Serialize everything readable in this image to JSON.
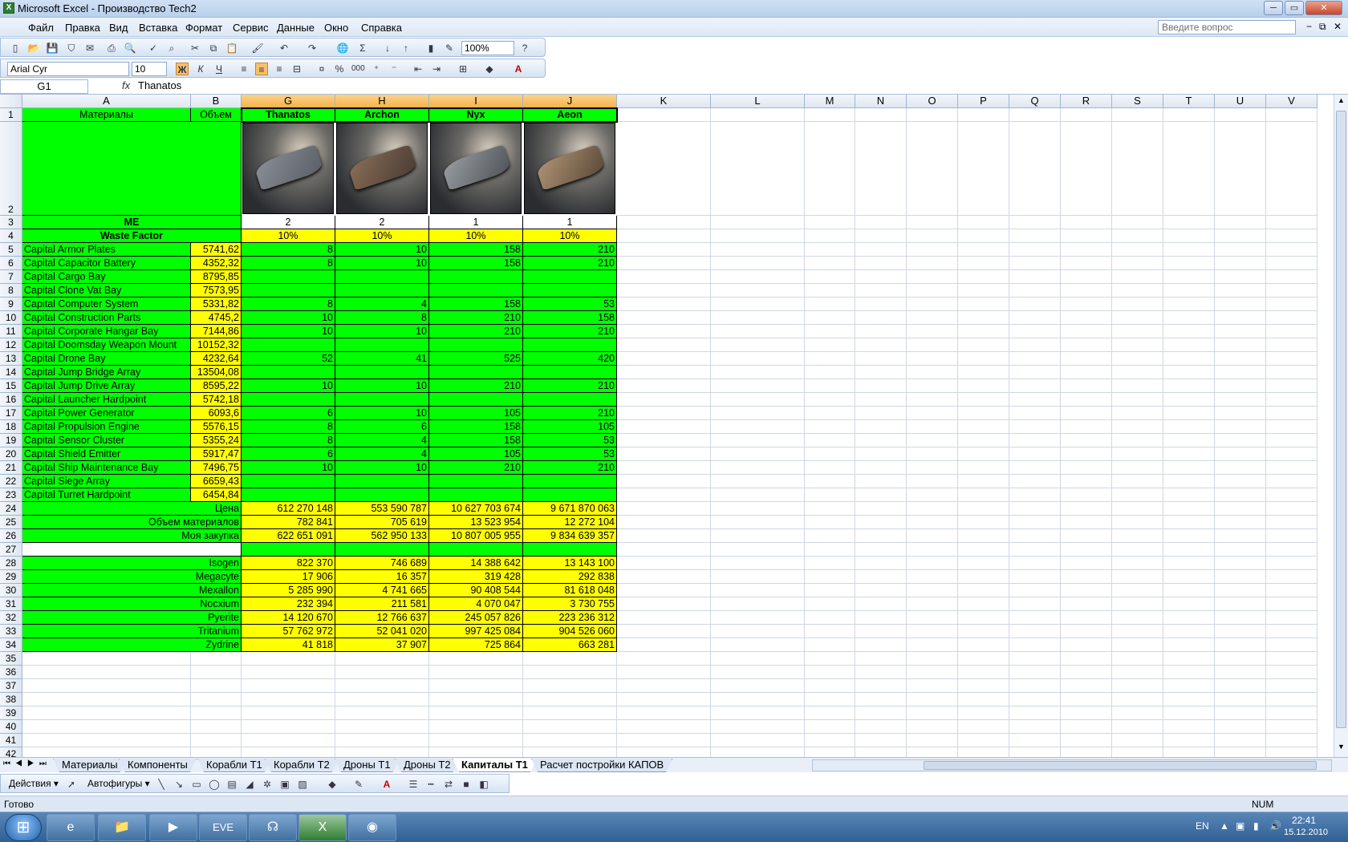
{
  "window": {
    "title": "Microsoft Excel - Производство Tech2",
    "btn_min": "─",
    "btn_max": "▭",
    "btn_close": "✕",
    "doc_min": "−",
    "doc_restore": "⧉",
    "doc_close": "✕"
  },
  "menu": {
    "items": [
      "Файл",
      "Правка",
      "Вид",
      "Вставка",
      "Формат",
      "Сервис",
      "Данные",
      "Окно",
      "Справка"
    ],
    "ask_placeholder": "Введите вопрос"
  },
  "toolbar": {
    "zoom": "100%",
    "font": "Arial Cyr",
    "size": "10",
    "bold": "Ж",
    "italic": "К",
    "underline": "Ч",
    "percent": "%",
    "thousands": "000"
  },
  "formula": {
    "namebox": "G1",
    "fx": "fx",
    "content": "Thanatos"
  },
  "columns": [
    "A",
    "B",
    "G",
    "H",
    "I",
    "J",
    "K",
    "L",
    "M",
    "N",
    "O",
    "P",
    "Q",
    "R",
    "S",
    "T",
    "U",
    "V"
  ],
  "rows": [
    "1",
    "2",
    "3",
    "4",
    "5",
    "6",
    "7",
    "8",
    "9",
    "10",
    "11",
    "12",
    "13",
    "14",
    "15",
    "16",
    "17",
    "18",
    "19",
    "20",
    "21",
    "22",
    "23",
    "24",
    "25",
    "26",
    "27",
    "28",
    "29",
    "30",
    "31",
    "32",
    "33",
    "34",
    "35",
    "36",
    "37",
    "38",
    "39",
    "40",
    "41",
    "42"
  ],
  "sheet": {
    "header": {
      "a": "Материалы",
      "b": "Объем",
      "ships": [
        "Thanatos",
        "Archon",
        "Nyx",
        "Aeon"
      ]
    },
    "me": {
      "label": "ME",
      "values": [
        "2",
        "2",
        "1",
        "1"
      ]
    },
    "waste": {
      "label": "Waste Factor",
      "values": [
        "10%",
        "10%",
        "10%",
        "10%"
      ]
    },
    "materials": [
      {
        "name": "Capital Armor Plates",
        "vol": "5741,62",
        "v": [
          "8",
          "10",
          "158",
          "210"
        ]
      },
      {
        "name": "Capital Capacitor Battery",
        "vol": "4352,32",
        "v": [
          "8",
          "10",
          "158",
          "210"
        ]
      },
      {
        "name": "Capital Cargo Bay",
        "vol": "8795,85",
        "v": [
          "",
          "",
          "",
          ""
        ]
      },
      {
        "name": "Capital Clone Vat Bay",
        "vol": "7573,95",
        "v": [
          "",
          "",
          "",
          ""
        ]
      },
      {
        "name": "Capital Computer System",
        "vol": "5331,82",
        "v": [
          "8",
          "4",
          "158",
          "53"
        ]
      },
      {
        "name": "Capital Construction Parts",
        "vol": "4745,2",
        "v": [
          "10",
          "8",
          "210",
          "158"
        ]
      },
      {
        "name": "Capital Corporate Hangar Bay",
        "vol": "7144,86",
        "v": [
          "10",
          "10",
          "210",
          "210"
        ]
      },
      {
        "name": "Capital Doomsday Weapon Mount",
        "vol": "10152,32",
        "v": [
          "",
          "",
          "",
          ""
        ]
      },
      {
        "name": "Capital Drone Bay",
        "vol": "4232,64",
        "v": [
          "52",
          "41",
          "525",
          "420"
        ]
      },
      {
        "name": "Capital Jump Bridge Array",
        "vol": "13504,08",
        "v": [
          "",
          "",
          "",
          ""
        ]
      },
      {
        "name": "Capital Jump Drive Array",
        "vol": "8595,22",
        "v": [
          "10",
          "10",
          "210",
          "210"
        ]
      },
      {
        "name": "Capital Launcher Hardpoint",
        "vol": "5742,18",
        "v": [
          "",
          "",
          "",
          ""
        ]
      },
      {
        "name": "Capital Power Generator",
        "vol": "6093,6",
        "v": [
          "6",
          "10",
          "105",
          "210"
        ]
      },
      {
        "name": "Capital Propulsion Engine",
        "vol": "5576,15",
        "v": [
          "8",
          "6",
          "158",
          "105"
        ]
      },
      {
        "name": "Capital Sensor Cluster",
        "vol": "5355,24",
        "v": [
          "8",
          "4",
          "158",
          "53"
        ]
      },
      {
        "name": "Capital Shield Emitter",
        "vol": "5917,47",
        "v": [
          "6",
          "4",
          "105",
          "53"
        ]
      },
      {
        "name": "Capital Ship Maintenance Bay",
        "vol": "7496,75",
        "v": [
          "10",
          "10",
          "210",
          "210"
        ]
      },
      {
        "name": "Capital Siege Array",
        "vol": "6659,43",
        "v": [
          "",
          "",
          "",
          ""
        ]
      },
      {
        "name": "Capital Turret Hardpoint",
        "vol": "6454,84",
        "v": [
          "",
          "",
          "",
          ""
        ]
      }
    ],
    "totals": [
      {
        "label": "Цена",
        "v": [
          "612 270 148",
          "553 590 787",
          "10 627 703 674",
          "9 671 870 063"
        ]
      },
      {
        "label": "Объем материалов",
        "v": [
          "782 841",
          "705 619",
          "13 523 954",
          "12 272 104"
        ]
      },
      {
        "label": "Моя закупка",
        "v": [
          "622 651 091",
          "562 950 133",
          "10 807 005 955",
          "9 834 639 357"
        ]
      }
    ],
    "minerals": [
      {
        "label": "Isogen",
        "v": [
          "822 370",
          "746 689",
          "14 388 642",
          "13 143 100"
        ]
      },
      {
        "label": "Megacyte",
        "v": [
          "17 906",
          "16 357",
          "319 428",
          "292 838"
        ]
      },
      {
        "label": "Mexallon",
        "v": [
          "5 285 990",
          "4 741 665",
          "90 408 544",
          "81 618 048"
        ]
      },
      {
        "label": "Nocxium",
        "v": [
          "232 394",
          "211 581",
          "4 070 047",
          "3 730 755"
        ]
      },
      {
        "label": "Pyerite",
        "v": [
          "14 120 670",
          "12 766 637",
          "245 057 826",
          "223 236 312"
        ]
      },
      {
        "label": "Tritanium",
        "v": [
          "57 762 972",
          "52 041 020",
          "997 425 084",
          "904 526 060"
        ]
      },
      {
        "label": "Zydrine",
        "v": [
          "41 818",
          "37 907",
          "725 864",
          "663 281"
        ]
      }
    ]
  },
  "tabs": [
    "Материалы",
    "Компоненты",
    "Корабли Т1",
    "Корабли Т2",
    "Дроны Т1",
    "Дроны Т2",
    "Капиталы Т1",
    "Расчет постройки КАПОВ"
  ],
  "active_tab": "Капиталы Т1",
  "drawbar": {
    "actions": "Действия ▾",
    "autoshapes": "Автофигуры ▾"
  },
  "status": {
    "text": "Готово",
    "num": "NUM"
  },
  "taskbar": {
    "lang": "EN",
    "time": "22:41",
    "date": "15.12.2010",
    "app_eve": "EVE"
  },
  "colors": {
    "green": "#00ff00",
    "yellow": "#ffff00"
  }
}
